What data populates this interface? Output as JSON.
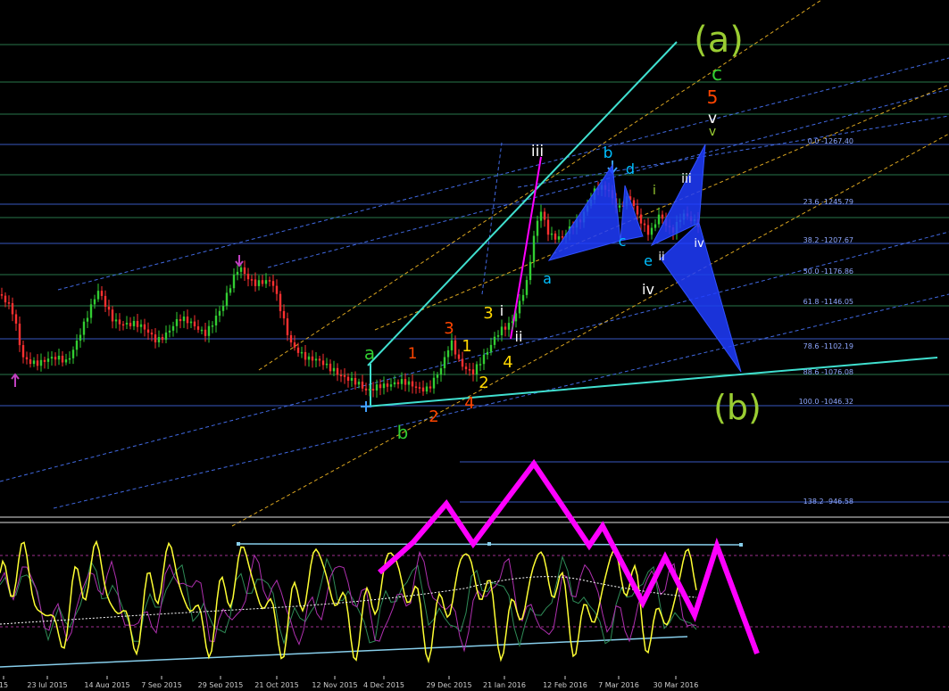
{
  "chart_data": {
    "type": "candlestick",
    "panels": [
      {
        "name": "price"
      },
      {
        "name": "oscillator"
      }
    ],
    "x_ticks": [
      "15",
      "23 Jul 2015",
      "14 Aug 2015",
      "7 Sep 2015",
      "29 Sep 2015",
      "21 Oct 2015",
      "12 Nov 2015",
      "4 Dec 2015",
      "29 Dec 2015",
      "21 Jan 2016",
      "12 Feb 2016",
      "7 Mar 2016",
      "30 Mar 2016"
    ],
    "price_range": [
      900,
      1320
    ],
    "fib_levels": [
      {
        "label": "0.0 -1267.40",
        "ratio": 0.0,
        "price": 1267.4
      },
      {
        "label": "23.6 -1245.79",
        "ratio": 23.6,
        "price": 1245.79
      },
      {
        "label": "38.2 -1207.67",
        "ratio": 38.2,
        "price": 1207.67
      },
      {
        "label": "50.0 -1176.86",
        "ratio": 50.0,
        "price": 1176.86
      },
      {
        "label": "61.8 -1146.05",
        "ratio": 61.8,
        "price": 1146.05
      },
      {
        "label": "78.6 -1102.19",
        "ratio": 78.6,
        "price": 1102.19
      },
      {
        "label": "88.6 -1076.08",
        "ratio": 88.6,
        "price": 1076.08
      },
      {
        "label": "100.0 -1046.32",
        "ratio": 100.0,
        "price": 1046.32
      },
      {
        "label": "138.2 -946.58",
        "ratio": 138.2,
        "price": 946.58
      }
    ],
    "wave_labels": [
      {
        "text": "(a)",
        "color": "#9acd32"
      },
      {
        "text": "c",
        "color": "#32cd32"
      },
      {
        "text": "5",
        "color": "#ff4500"
      },
      {
        "text": "v",
        "color": "#ffffff"
      },
      {
        "text": "v",
        "color": "#9acd32"
      },
      {
        "text": "iii",
        "color": "#ffffff"
      },
      {
        "text": "b",
        "color": "#00bfff"
      },
      {
        "text": "d",
        "color": "#00bfff"
      },
      {
        "text": "i",
        "color": "#9acd32"
      },
      {
        "text": "iii",
        "color": "#ffffff"
      },
      {
        "text": "c",
        "color": "#00bfff"
      },
      {
        "text": "iv",
        "color": "#ffffff"
      },
      {
        "text": "e",
        "color": "#00bfff"
      },
      {
        "text": "ii",
        "color": "#ffffff"
      },
      {
        "text": "a",
        "color": "#00bfff"
      },
      {
        "text": "iv",
        "color": "#ffffff"
      },
      {
        "text": "3",
        "color": "#ffd700"
      },
      {
        "text": "i",
        "color": "#ffffff"
      },
      {
        "text": "3",
        "color": "#ff4500"
      },
      {
        "text": "1",
        "color": "#ffd700"
      },
      {
        "text": "ii",
        "color": "#ffffff"
      },
      {
        "text": "4",
        "color": "#ffd700"
      },
      {
        "text": "a",
        "color": "#32cd32"
      },
      {
        "text": "1",
        "color": "#ff4500"
      },
      {
        "text": "2",
        "color": "#ffd700"
      },
      {
        "text": "4",
        "color": "#ff4500"
      },
      {
        "text": "2",
        "color": "#ff4500"
      },
      {
        "text": "b",
        "color": "#32cd32"
      },
      {
        "text": "(b)",
        "color": "#9acd32"
      }
    ]
  }
}
